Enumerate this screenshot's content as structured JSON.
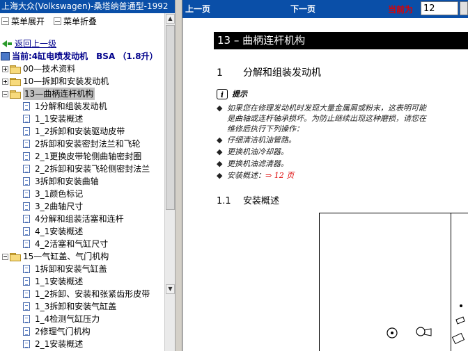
{
  "window": {
    "title": "上海大众(Volkswagen)-桑塔纳普通型-1992"
  },
  "menu": {
    "expand_label": "菜单展开",
    "collapse_label": "菜单折叠"
  },
  "tree": {
    "back_label": "返回上一级",
    "current_label": "当前:4缸电喷发动机　BSA （1.8升）",
    "items": [
      {
        "label": "00—技术资料",
        "type": "folder",
        "toggle": "plus",
        "level": 0
      },
      {
        "label": "10—拆卸和安装发动机",
        "type": "folder",
        "toggle": "plus",
        "level": 0
      },
      {
        "label": "13—曲柄连杆机构",
        "type": "folder",
        "toggle": "minus",
        "level": 0,
        "selected": true
      },
      {
        "label": "1分解和组装发动机",
        "type": "doc",
        "level": 1
      },
      {
        "label": "1_1安装概述",
        "type": "doc",
        "level": 1
      },
      {
        "label": "1_2拆卸和安装驱动皮带",
        "type": "doc",
        "level": 1
      },
      {
        "label": "2拆卸和安装密封法兰和飞轮",
        "type": "doc",
        "level": 1
      },
      {
        "label": "2_1更换皮带轮侧曲轴密封圈",
        "type": "doc",
        "level": 1
      },
      {
        "label": "2_2拆卸和安装飞轮侧密封法兰",
        "type": "doc",
        "level": 1
      },
      {
        "label": "3拆卸和安装曲轴",
        "type": "doc",
        "level": 1
      },
      {
        "label": "3_1颜色标记",
        "type": "doc",
        "level": 1
      },
      {
        "label": "3_2曲轴尺寸",
        "type": "doc",
        "level": 1
      },
      {
        "label": "4分解和组装活塞和连杆",
        "type": "doc",
        "level": 1
      },
      {
        "label": "4_1安装概述",
        "type": "doc",
        "level": 1
      },
      {
        "label": "4_2活塞和气缸尺寸",
        "type": "doc",
        "level": 1
      },
      {
        "label": "15—气缸盖、气门机构",
        "type": "folder",
        "toggle": "minus",
        "level": 0
      },
      {
        "label": "1拆卸和安装气缸盖",
        "type": "doc",
        "level": 1
      },
      {
        "label": "1_1安装概述",
        "type": "doc",
        "level": 1
      },
      {
        "label": "1_2拆卸、安装和张紧齿形皮带",
        "type": "doc",
        "level": 1
      },
      {
        "label": "1_3拆卸和安装气缸盖",
        "type": "doc",
        "level": 1
      },
      {
        "label": "1_4检测气缸压力",
        "type": "doc",
        "level": 1
      },
      {
        "label": "2修理气门机构",
        "type": "doc",
        "level": 1
      },
      {
        "label": "2_1安装概述",
        "type": "doc",
        "level": 1
      }
    ]
  },
  "nav": {
    "prev_label": "上一页",
    "next_label": "下一页",
    "page_label": "当前为",
    "page_value": "12"
  },
  "document": {
    "chapter_title": "13 – 曲柄连杆机构",
    "section_number": "1",
    "section_title": "分解和组装发动机",
    "hint_icon": "i",
    "hint_label": "提示",
    "bullets": [
      {
        "text": "如果您在修理发动机时发现大量金属屑或粉末，这表明可能是曲轴或连杆轴承损坏。为防止继续出现这种磨损，请您在维修后执行下列操作："
      },
      {
        "text": "仔细清洁机油管路。"
      },
      {
        "text": "更换机油冷却器。"
      },
      {
        "text": "更换机油滤清器。"
      },
      {
        "text": "安装概述：",
        "link": "⇒ 12 页"
      }
    ],
    "subsection_number": "1.1",
    "subsection_title": "安装概述"
  },
  "colors": {
    "title_bar": "#0a4fa8",
    "page_label": "#d00000",
    "link": "#00008b"
  }
}
